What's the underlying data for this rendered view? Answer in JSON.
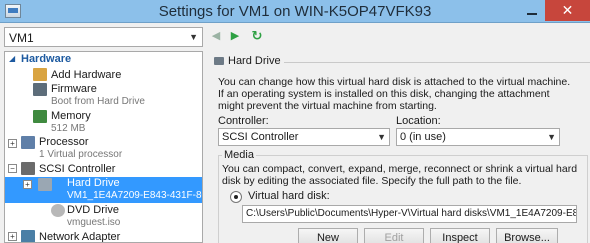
{
  "window": {
    "title": "Settings for VM1 on WIN-K5OP47VFK93",
    "close_glyph": "✕"
  },
  "toolbar": {
    "vm_selected": "VM1",
    "back_glyph": "◀",
    "forward_glyph": "▶",
    "refresh_glyph": "↻"
  },
  "tree": {
    "hardware_header": "Hardware",
    "items": [
      {
        "label": "Add Hardware",
        "sub": "",
        "icon": "add-hardware-icon"
      },
      {
        "label": "Firmware",
        "sub": "Boot from Hard Drive",
        "icon": "firmware-icon"
      },
      {
        "label": "Memory",
        "sub": "512 MB",
        "icon": "memory-icon"
      },
      {
        "label": "Processor",
        "sub": "1 Virtual processor",
        "icon": "processor-icon"
      },
      {
        "label": "SCSI Controller",
        "sub": "",
        "icon": "scsi-controller-icon"
      },
      {
        "label": "Hard Drive",
        "sub": "VM1_1E4A7209-E843-431F-80...",
        "icon": "hard-drive-icon"
      },
      {
        "label": "DVD Drive",
        "sub": "vmguest.iso",
        "icon": "dvd-drive-icon"
      },
      {
        "label": "Network Adapter",
        "sub": "",
        "icon": "network-adapter-icon"
      }
    ]
  },
  "panel": {
    "heading": "Hard Drive",
    "description": "You can change how this virtual hard disk is attached to the virtual machine. If an operating system is installed on this disk, changing the attachment might prevent the virtual machine from starting.",
    "controller_label": "Controller:",
    "controller_value": "SCSI Controller",
    "location_label": "Location:",
    "location_value": "0 (in use)",
    "media_label": "Media",
    "media_description": "You can compact, convert, expand, merge, reconnect or shrink a virtual hard disk by editing the associated file. Specify the full path to the file.",
    "vhd_label": "Virtual hard disk:",
    "vhd_path": "C:\\Users\\Public\\Documents\\Hyper-V\\Virtual hard disks\\VM1_1E4A7209-E843-43",
    "buttons": {
      "new": "New",
      "edit": "Edit",
      "inspect": "Inspect",
      "browse": "Browse..."
    }
  }
}
